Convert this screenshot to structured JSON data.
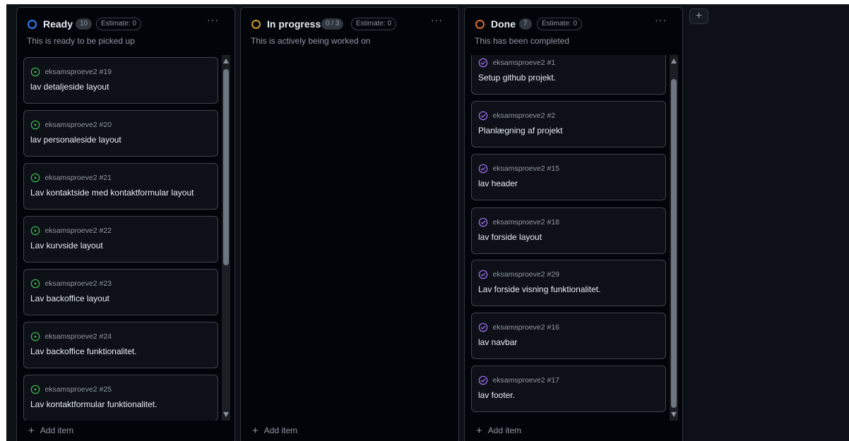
{
  "board": {
    "add_column_label": "+",
    "columns": [
      {
        "title": "Ready",
        "count": "10",
        "estimate": "Estimate: 0",
        "description": "This is ready to be picked up",
        "status_color": "#2f81f7",
        "menu_label": "···",
        "add_item_label": "Add item",
        "cards": [
          {
            "repo": "eksamsproeve2 #19",
            "title": "lav detaljeside layout"
          },
          {
            "repo": "eksamsproeve2 #20",
            "title": "lav personaleside layout"
          },
          {
            "repo": "eksamsproeve2 #21",
            "title": "Lav kontaktside med kontaktformular layout"
          },
          {
            "repo": "eksamsproeve2 #22",
            "title": "Lav kurvside layout"
          },
          {
            "repo": "eksamsproeve2 #23",
            "title": "Lav backoffice layout"
          },
          {
            "repo": "eksamsproeve2 #24",
            "title": "Lav backoffice funktionalitet."
          },
          {
            "repo": "eksamsproeve2 #25",
            "title": "Lav kontaktformular funktionalitet."
          }
        ]
      },
      {
        "title": "In progress",
        "count": "0 / 3",
        "estimate": "Estimate: 0",
        "description": "This is actively being worked on",
        "status_color": "#d29922",
        "menu_label": "···",
        "add_item_label": "Add item",
        "cards": []
      },
      {
        "title": "Done",
        "count": "7",
        "estimate": "Estimate: 0",
        "description": "This has been completed",
        "status_color": "#db6d28",
        "menu_label": "···",
        "add_item_label": "Add item",
        "cards": [
          {
            "repo": "eksamsproeve2 #1",
            "title": "Setup github projekt."
          },
          {
            "repo": "eksamsproeve2 #2",
            "title": "Planlægning af projekt"
          },
          {
            "repo": "eksamsproeve2 #15",
            "title": "lav header"
          },
          {
            "repo": "eksamsproeve2 #18",
            "title": "lav forside layout"
          },
          {
            "repo": "eksamsproeve2 #29",
            "title": "Lav forside visning funktionalitet."
          },
          {
            "repo": "eksamsproeve2 #16",
            "title": "lav navbar"
          },
          {
            "repo": "eksamsproeve2 #17",
            "title": "lav footer."
          }
        ]
      }
    ]
  },
  "icons": {
    "open_issue": "issue-opened-icon",
    "closed_issue": "issue-closed-icon",
    "open_color": "#3fb950",
    "closed_color": "#a371f7"
  }
}
